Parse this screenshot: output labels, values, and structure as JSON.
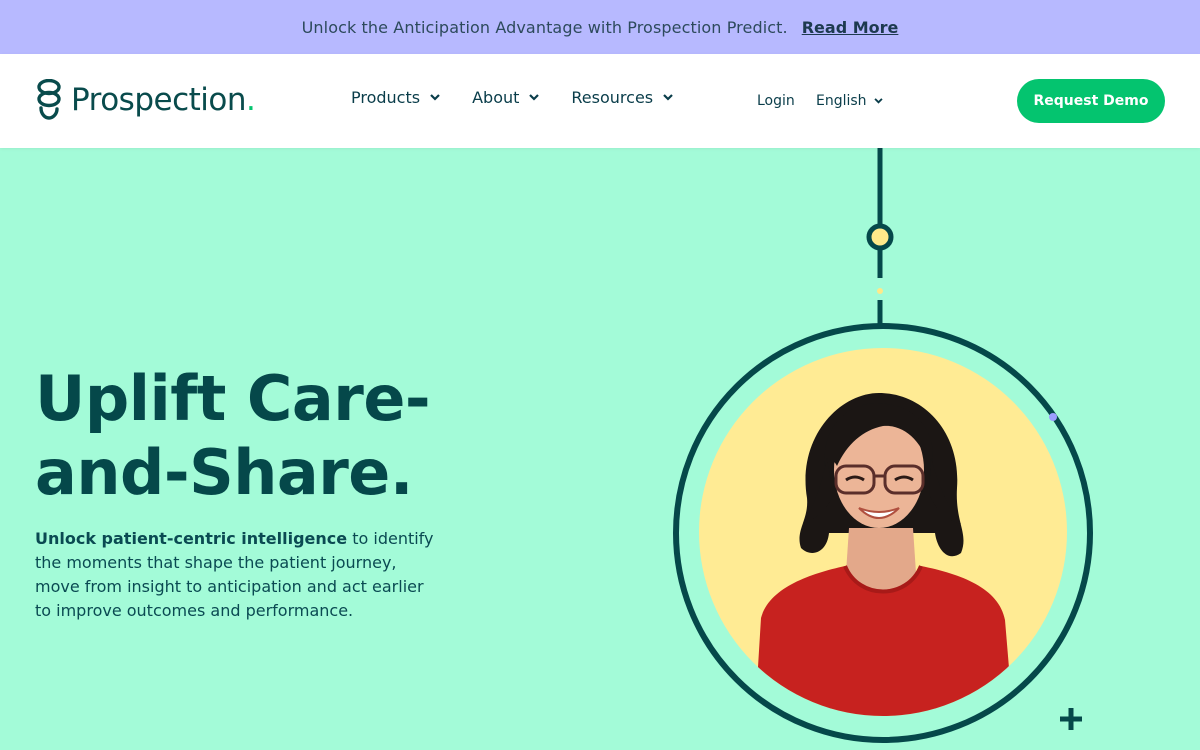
{
  "announcement": {
    "message": "Unlock the Anticipation Advantage with Prospection Predict.",
    "link_label": "Read More"
  },
  "nav": {
    "logo_text": "Prospection",
    "logo_dot": ".",
    "menu": [
      {
        "label": "Products"
      },
      {
        "label": "About"
      },
      {
        "label": "Resources"
      }
    ],
    "login_label": "Login",
    "language_label": "English",
    "cta_label": "Request Demo"
  },
  "hero": {
    "title_line1": "Uplift Care-",
    "title_line2": "and-Share.",
    "desc_bold": "Unlock patient-centric intelligence",
    "desc_rest": " to identify the moments that shape the patient journey, move from insight to anticipation and act earlier to improve outcomes and performance."
  },
  "colors": {
    "announcement_bg": "#b7b9ff",
    "hero_bg": "#a3fbd8",
    "primary_dark": "#05484a",
    "accent_green": "#04c46f",
    "portrait_bg": "#ffeb94",
    "shirt_red": "#c7221f"
  },
  "icons": [
    "prospection-logo-icon",
    "chevron-down-icon",
    "plus-icon"
  ]
}
